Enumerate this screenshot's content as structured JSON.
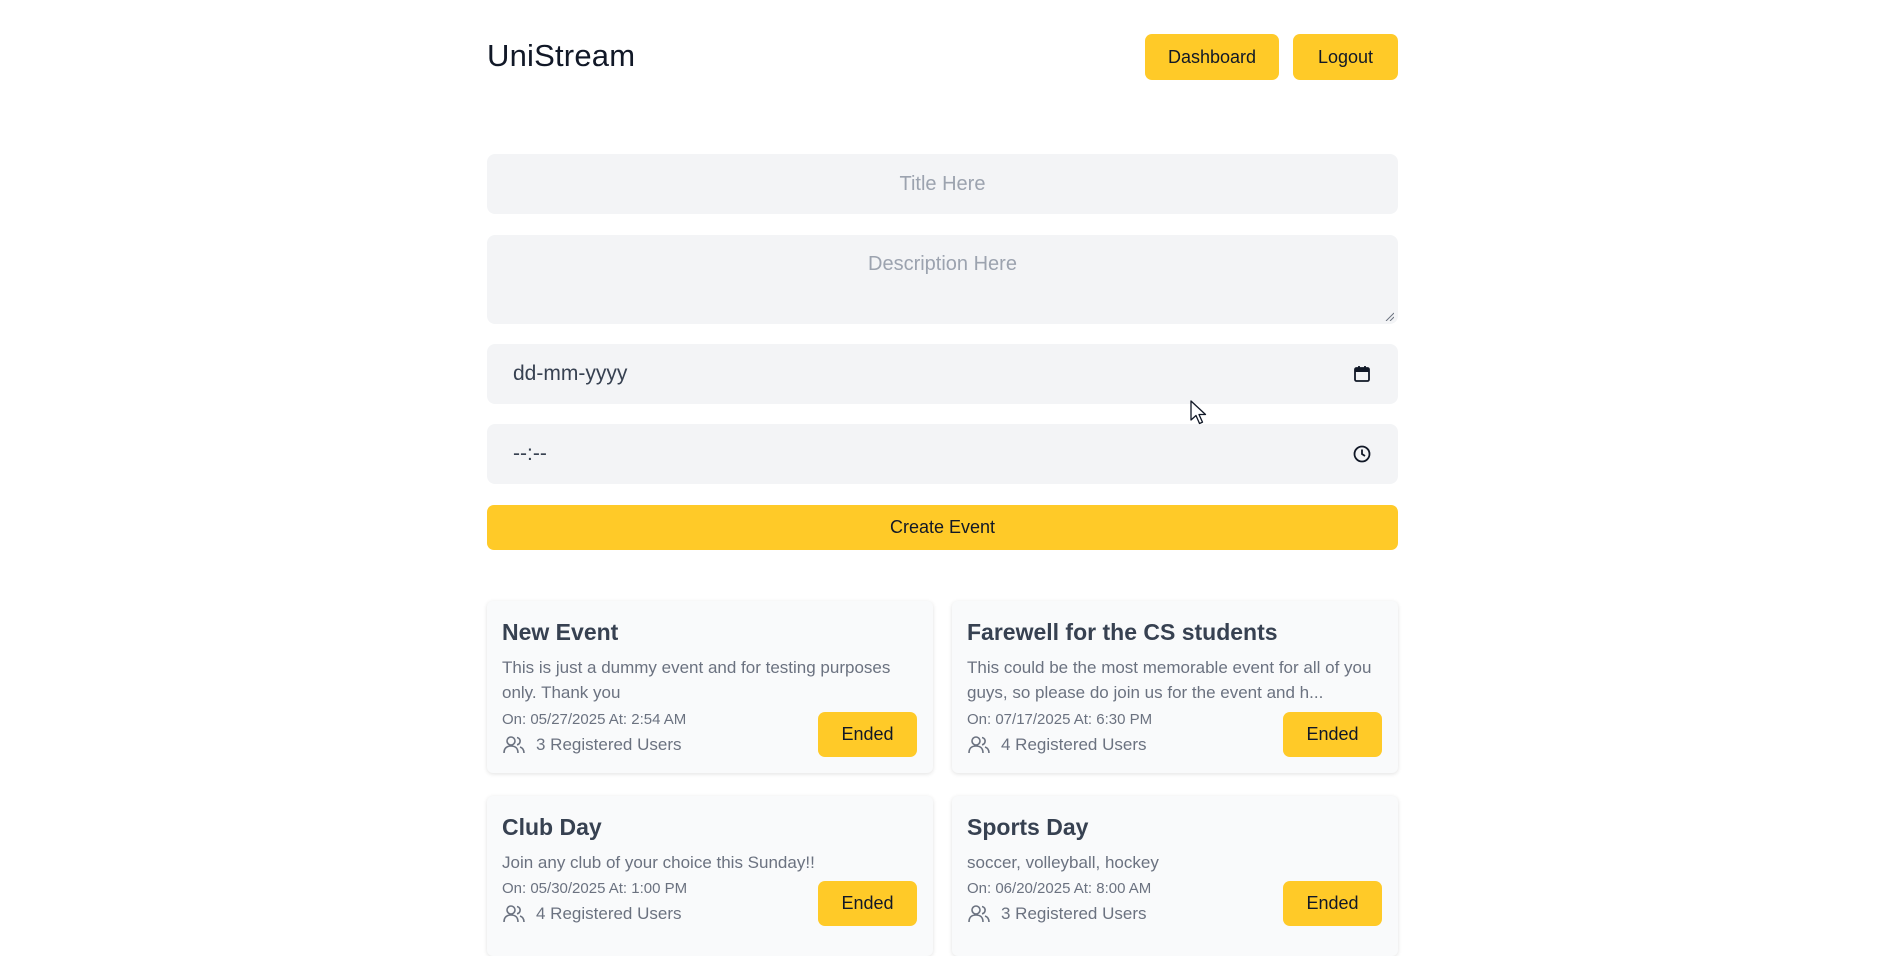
{
  "header": {
    "brand": "UniStream",
    "dashboard_label": "Dashboard",
    "logout_label": "Logout"
  },
  "form": {
    "title_placeholder": "Title Here",
    "description_placeholder": "Description Here",
    "date_value": "dd-mm-yyyy",
    "time_value": "--:--",
    "submit_label": "Create Event"
  },
  "events": [
    {
      "title": "New Event",
      "description": "This is just a dummy event and for testing purposes only. Thank you",
      "datetime": "On: 05/27/2025 At: 2:54 AM",
      "registered": "3 Registered Users",
      "status": "Ended"
    },
    {
      "title": "Farewell for the CS students",
      "description": "This could be the most memorable event for all of you guys, so please do join us for the event and h...",
      "datetime": "On: 07/17/2025 At: 6:30 PM",
      "registered": "4 Registered Users",
      "status": "Ended"
    },
    {
      "title": "Club Day",
      "description": "Join any club of your choice this Sunday!!",
      "datetime": "On: 05/30/2025 At: 1:00 PM",
      "registered": "4 Registered Users",
      "status": "Ended"
    },
    {
      "title": "Sports Day",
      "description": "soccer, volleyball, hockey",
      "datetime": "On: 06/20/2025 At: 8:00 AM",
      "registered": "3 Registered Users",
      "status": "Ended"
    }
  ],
  "colors": {
    "accent": "#ffca28",
    "field_bg": "#f3f4f6",
    "card_bg": "#f9fafb"
  },
  "icons": {
    "date": "calendar-icon",
    "time": "clock-icon",
    "users": "users-icon",
    "cursor": "mouse-cursor-icon"
  }
}
